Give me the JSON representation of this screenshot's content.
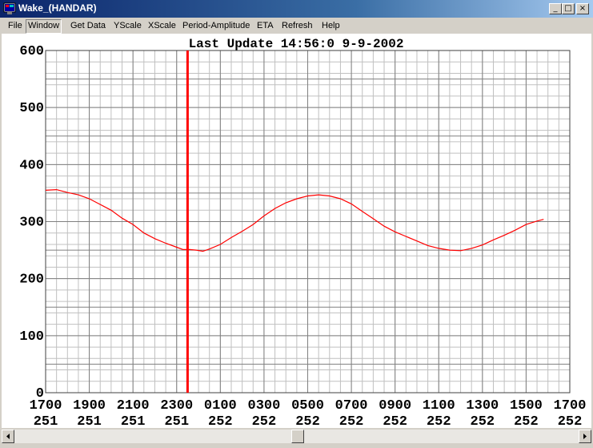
{
  "window": {
    "title": "Wake_(HANDAR)",
    "minimize": "_",
    "maximize": "□",
    "close": "×"
  },
  "menu": [
    {
      "label": "File",
      "active": false
    },
    {
      "label": "Window",
      "active": true
    },
    {
      "label": "Get Data",
      "active": false
    },
    {
      "label": "YScale",
      "active": false
    },
    {
      "label": "XScale",
      "active": false
    },
    {
      "label": "Period-Amplitude",
      "active": false
    },
    {
      "label": "ETA",
      "active": false
    },
    {
      "label": "Refresh",
      "active": false
    },
    {
      "label": "Help",
      "active": false
    }
  ],
  "chart_data": {
    "type": "line",
    "title": "Last Update  14:56:0   9-9-2002",
    "ylim": [
      0,
      600
    ],
    "yticks": [
      "0",
      "100",
      "200",
      "300",
      "400",
      "500",
      "600"
    ],
    "xlim": [
      0,
      24
    ],
    "xticks": [
      {
        "time": "1700",
        "day": "251"
      },
      {
        "time": "1900",
        "day": "251"
      },
      {
        "time": "2100",
        "day": "251"
      },
      {
        "time": "2300",
        "day": "251"
      },
      {
        "time": "0100",
        "day": "252"
      },
      {
        "time": "0300",
        "day": "252"
      },
      {
        "time": "0500",
        "day": "252"
      },
      {
        "time": "0700",
        "day": "252"
      },
      {
        "time": "0900",
        "day": "252"
      },
      {
        "time": "1100",
        "day": "252"
      },
      {
        "time": "1300",
        "day": "252"
      },
      {
        "time": "1500",
        "day": "252"
      },
      {
        "time": "1700",
        "day": "252"
      }
    ],
    "grid": true,
    "marker_hour": 6.5,
    "series": [
      {
        "color": "#ff0000",
        "x": [
          0,
          0.5,
          1,
          1.5,
          2,
          2.5,
          3,
          3.5,
          4,
          4.5,
          5,
          5.5,
          6,
          6.3,
          6.6,
          6.9,
          7.2,
          7.5,
          8,
          8.5,
          9,
          9.5,
          10,
          10.5,
          11,
          11.5,
          12,
          12.5,
          13,
          13.5,
          14,
          14.5,
          15,
          15.5,
          16,
          16.5,
          17,
          17.5,
          18,
          18.5,
          19,
          19.5,
          20,
          20.5,
          21,
          21.5,
          22,
          22.5,
          22.8
        ],
        "y": [
          355,
          356,
          351,
          347,
          340,
          330,
          320,
          306,
          295,
          280,
          270,
          262,
          255,
          251,
          251,
          250,
          248,
          252,
          260,
          272,
          283,
          295,
          310,
          323,
          333,
          340,
          345,
          347,
          345,
          340,
          331,
          318,
          305,
          292,
          282,
          274,
          266,
          258,
          253,
          250,
          249,
          253,
          259,
          268,
          276,
          285,
          295,
          301,
          304
        ]
      }
    ]
  }
}
